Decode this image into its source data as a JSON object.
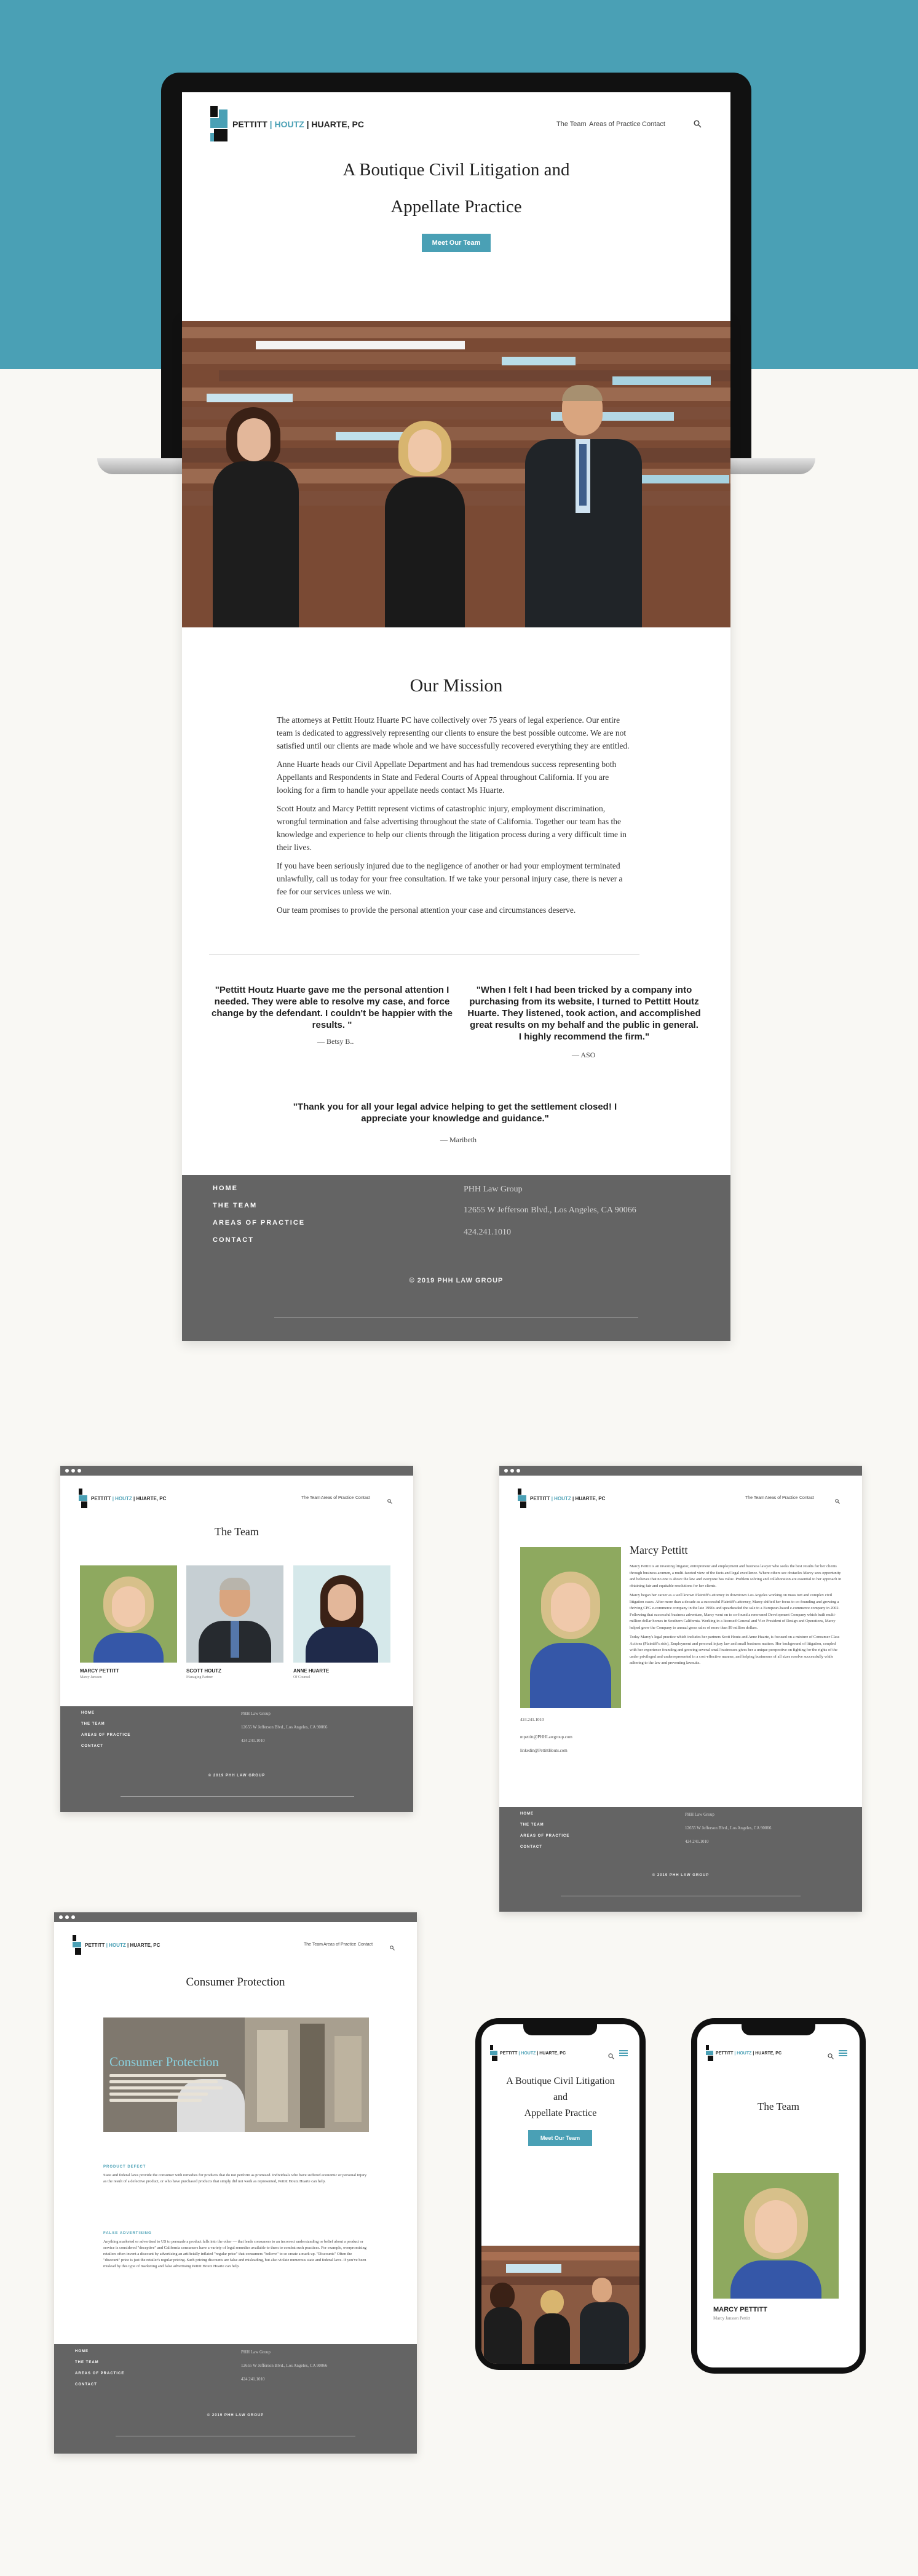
{
  "colors": {
    "teal": "#4aa0b5",
    "footer": "#646464",
    "background": "#f9f8f4"
  },
  "brand": {
    "name_a": "PETTITT",
    "name_b": "HOUTZ",
    "name_c": "HUARTE, PC",
    "sep": "|"
  },
  "nav": {
    "team": "The Team",
    "areas": "Areas of Practice",
    "contact": "Contact",
    "search_icon": "search-icon"
  },
  "hero": {
    "title_line1": "A Boutique Civil Litigation and",
    "title_line2": "Appellate Practice",
    "cta": "Meet Our Team"
  },
  "mission": {
    "title": "Our Mission",
    "paragraphs": [
      "The attorneys at Pettitt Houtz Huarte PC have collectively over 75 years of legal experience. Our entire team is dedicated to aggressively representing our clients to ensure the best possible outcome. We are not satisfied until our clients are made whole and we have successfully recovered everything they are entitled.",
      "Anne Huarte heads our Civil Appellate Department and has had tremendous success representing both Appellants and Respondents in State and Federal Courts of Appeal throughout California. If you are looking for a firm to handle your appellate needs contact Ms Huarte.",
      "Scott Houtz and Marcy Pettitt represent victims of catastrophic injury, employment discrimination, wrongful termination and false advertising throughout the state of California. Together our team has the knowledge and experience to help our clients through the litigation process during a very difficult time in their lives.",
      "If you have been seriously injured due to the negligence of another or had your employment terminated unlawfully, call us today for your free consultation. If we take your personal injury case, there is never a fee for our services unless we win.",
      "Our team promises to provide the personal attention your case and circumstances deserve."
    ]
  },
  "testimonials": [
    {
      "text": "\"Pettitt Houtz Huarte gave me the personal attention I needed. They were able to resolve my case, and force change by the defendant. I couldn't be happier with the results. \"",
      "author": "— Betsy B.."
    },
    {
      "text": "\"When I felt I had been tricked by a company into purchasing from its website, I turned to Pettitt Houtz Huarte. They listened, took action, and accomplished great results on my behalf and the public in general. I highly recommend the firm.\"",
      "author": "— ASO"
    },
    {
      "text": "\"Thank you for all your legal advice helping to get the settlement closed! I appreciate your knowledge and guidance.\"",
      "author": "— Maribeth"
    }
  ],
  "footer": {
    "links": [
      "HOME",
      "THE TEAM",
      "AREAS OF PRACTICE",
      "CONTACT"
    ],
    "company": "PHH Law Group",
    "address": "12655 W Jefferson Blvd., Los Angeles, CA 90066",
    "phone": "424.241.1010",
    "copyright": "© 2019 PHH LAW GROUP"
  },
  "team_page": {
    "title": "The Team",
    "members": [
      {
        "name": "MARCY PETTITT",
        "role": "Marcy Janssen"
      },
      {
        "name": "SCOTT HOUTZ",
        "role": "Managing Partner"
      },
      {
        "name": "ANNE HUARTE",
        "role": "Of Counsel"
      }
    ]
  },
  "bio_page": {
    "name": "Marcy Pettitt",
    "phone": "424.241.1010",
    "email": "mpettitt@PHHLawgroup.com",
    "email2": "linkedin@PettittHouts.com",
    "paragraphs": [
      "Marcy Pettitt is an investing litigator, entrepreneur and employment and business lawyer who seeks the best results for her clients through business acumen, a multi-faceted view of the facts and legal excellence. Where others see obstacles Marcy sees opportunity and believes that no one is above the law and everyone has value. Problem solving and collaboration are essential to her approach in obtaining fair and equitable resolutions for her clients.",
      "Marcy began her career as a well known Plaintiff's attorney in downtown Los Angeles working on mass tort and complex civil litigation cases. After more than a decade as a successful Plaintiff's attorney, Marcy shifted her focus to co-founding and growing a thriving CPG e-commerce company in the late 1990s and spearheaded the sale to a European-based e-commerce company in 2002. Following that successful business adventure, Marcy went on to co-found a renowned Development Company which built multi-million dollar homes in Southern California. Working in a licensed General and Vice President of Design and Operations, Marcy helped grow the Company to annual gross sales of more than $9 million dollars.",
      "Today Marcy's legal practice which includes her partners Scott Houtz and Anne Huarte, is focused on a mixture of Consumer Class Actions (Plaintiff's side), Employment and personal injury law and small business matters. Her background of litigation, coupled with her experience founding and growing several small businesses gives her a unique perspective on fighting for the rights of the under privileged and underrepresented in a cost-effective manner, and helping businesses of all sizes resolve successfully while adhering to the law and preventing lawsuits."
    ]
  },
  "consumer_page": {
    "title": "Consumer Protection",
    "banner_title": "Consumer Protection",
    "sec1_label": "PRODUCT DEFECT",
    "sec1_text": "State and federal laws provide the consumer with remedies for products that do not perform as promised. Individuals who have suffered economic or personal injury as the result of a defective product, or who have purchased products that simply did not work as represented, Pettitt Houtz Huarte can help.",
    "sec2_label": "FALSE ADVERTISING",
    "sec2_text": "Anything marketed or advertised to US to persuade a product falls into the other — that leads consumers to an incorrect understanding or belief about a product or service is considered \"deceptive\" and California consumers have a variety of legal remedies available to them to combat such practices. For example, overpromising retailers often invent a discount by advertising an artificially inflated \"regular price\" that consumers \"believe\" to so create a mark up. \"Discounts\" Often the \"discount\" price is just the retailer's regular pricing. Such pricing discounts are false and misleading, but also violate numerous state and federal laws. If you've been mislead by this type of marketing and false advertising Pettitt Houtz Huarte can help."
  },
  "mobile": {
    "hero_line1": "A Boutique Civil Litigation",
    "hero_line2": "and",
    "hero_line3": "Appellate Practice",
    "cta": "Meet Our Team",
    "team_title": "The Team",
    "member_name": "MARCY PETTITT",
    "member_role": "Marcy Janssen Pettitt"
  }
}
